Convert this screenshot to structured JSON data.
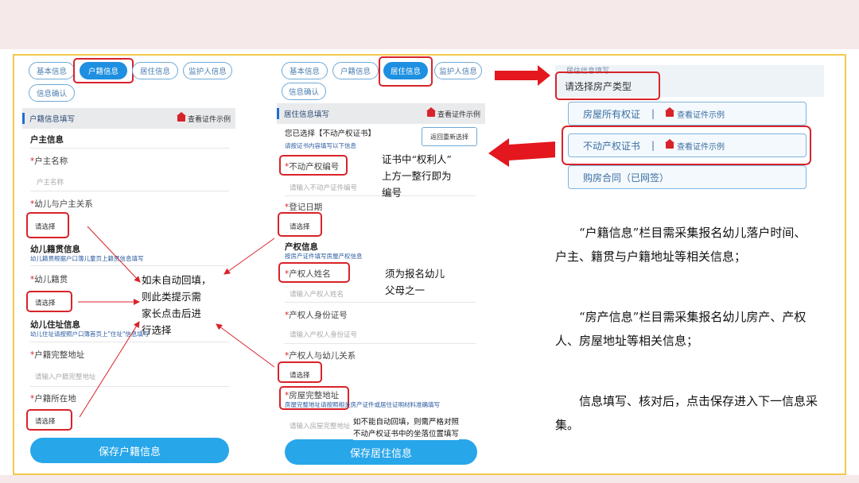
{
  "phone1": {
    "tabs": [
      "基本信息",
      "户籍信息",
      "居住信息",
      "监护人信息",
      "信息确认"
    ],
    "section_title": "户籍信息填写",
    "example_link": "查看证件示例",
    "owner_heading": "户主信息",
    "owner_name_label": "户主名称",
    "owner_name_placeholder": "户主名称",
    "relation_label": "幼儿与户主关系",
    "select_text": "请选择",
    "native_heading": "幼儿籍贯信息",
    "native_sub": "幼儿籍贯根据户口簿儿童页上籍贯信息填写",
    "native_label": "幼儿籍贯",
    "address_heading": "幼儿住址信息",
    "address_sub": "幼儿住址请按照户口簿首页上\"住址\"信息填写",
    "full_address_label": "户籍完整地址",
    "full_address_placeholder": "请输入户籍完整地址",
    "location_label": "户籍所在地",
    "save_button": "保存户籍信息"
  },
  "phone2": {
    "tabs": [
      "基本信息",
      "户籍信息",
      "居住信息",
      "监护人信息",
      "信息确认"
    ],
    "section_title": "居住信息填写",
    "example_link": "查看证件示例",
    "chosen_text": "您已选择【不动产权证书】",
    "chosen_sub": "请按证书内容填写以下信息",
    "reset_button": "返回重新选择",
    "cert_no_label": "不动产权编号",
    "cert_no_placeholder": "请输入不动产证件编号",
    "reg_date_label": "登记日期",
    "select_text": "请选择",
    "property_heading": "产权信息",
    "property_sub": "按房产证件填写房屋产权信息",
    "owner_name_label": "产权人姓名",
    "owner_name_placeholder": "请输入产权人姓名",
    "owner_id_label": "产权人身份证号",
    "owner_id_placeholder": "请输入产权人身份证号",
    "owner_relation_label": "产权人与幼儿关系",
    "house_address_label": "房屋完整地址",
    "house_address_sub": "房屋完整地址请按照相关房产证件或居住证明材料准确填写",
    "house_address_placeholder": "请输入房屋完整地址",
    "save_button": "保存居住信息"
  },
  "annotations": {
    "auto_fill": [
      "如未自动回填，",
      "则此类提示需",
      "家长点击后进",
      "行选择"
    ],
    "cert_note": [
      "证书中“权利人”",
      "上方一整行即为",
      "编号"
    ],
    "owner_note": [
      "须为报名幼儿",
      "父母之一"
    ],
    "address_note": [
      "如不能自动回填，则需严格对照",
      "不动产权证书中的坐落位置填写"
    ]
  },
  "right_panel": {
    "header_title": "居住信息填写",
    "prompt": "请选择房产类型",
    "options": [
      {
        "name": "房屋所有权证",
        "link": "查看证件示例"
      },
      {
        "name": "不动产权证书",
        "link": "查看证件示例"
      },
      {
        "name": "购房合同（已网签）",
        "link": ""
      }
    ],
    "separator": "|"
  },
  "paragraphs": [
    "“户籍信息”栏目需采集报名幼儿落户时间、户主、籍贯与户籍地址等相关信息；",
    "“房产信息”栏目需采集报名幼儿房产、产权人、房屋地址等相关信息；",
    "信息填写、核对后，点击保存进入下一信息采集。"
  ],
  "colors": {
    "accent": "#1e8fe1",
    "annotation_red": "#d8232a",
    "frame": "#f2c94c"
  }
}
